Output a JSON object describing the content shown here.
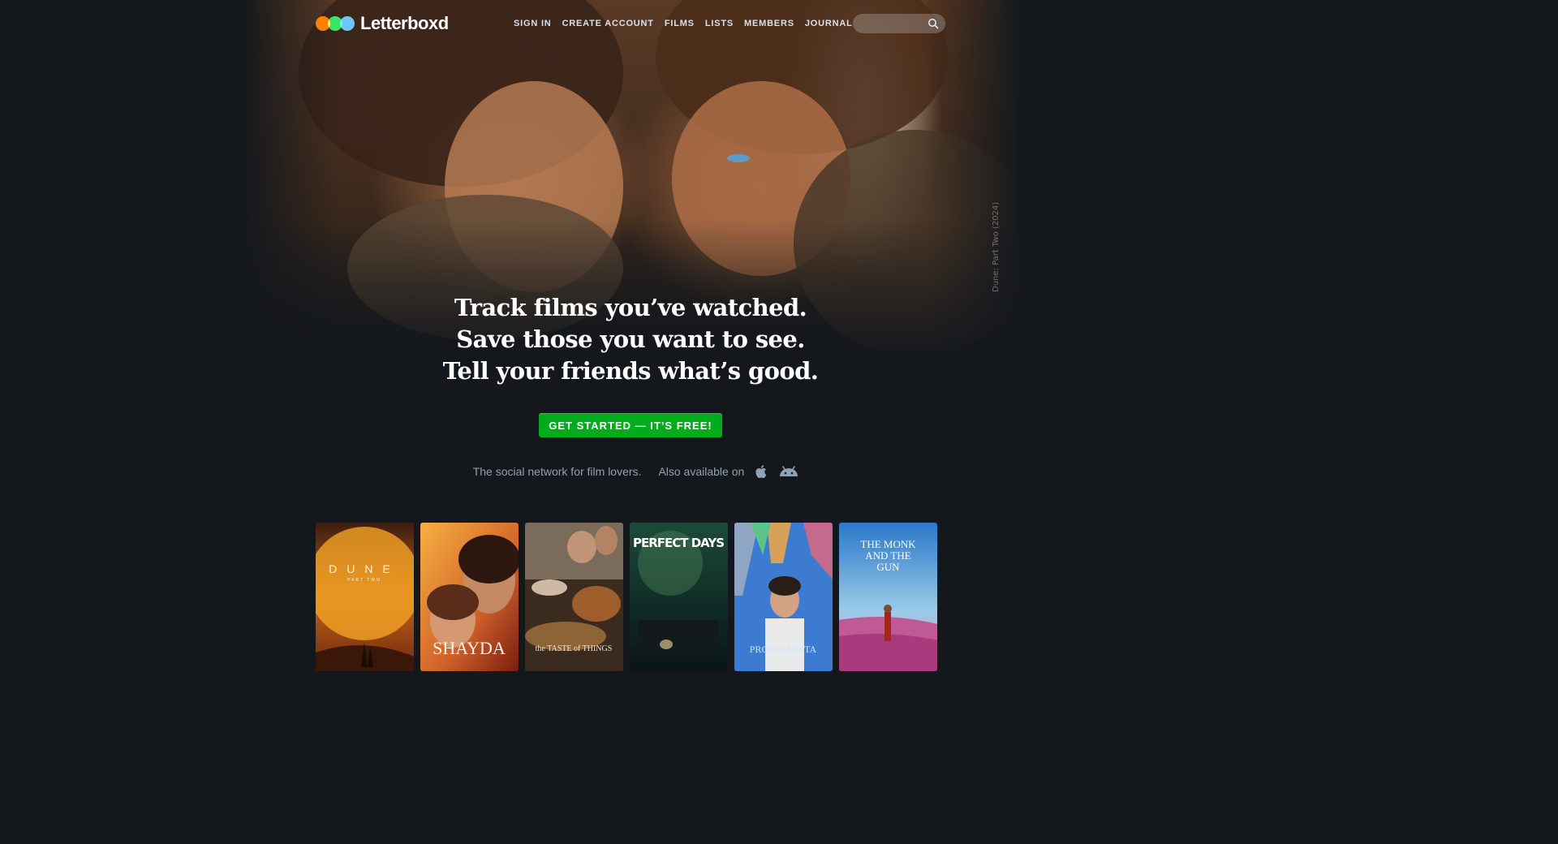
{
  "site": {
    "name": "Letterboxd"
  },
  "nav": {
    "sign_in": "SIGN IN",
    "create_account": "CREATE ACCOUNT",
    "films": "FILMS",
    "lists": "LISTS",
    "members": "MEMBERS",
    "journal": "JOURNAL"
  },
  "search": {
    "placeholder": ""
  },
  "hero": {
    "caption": "Dune: Part Two (2024)"
  },
  "tagline": {
    "line1": "Track films you’ve watched.",
    "line2": "Save those you want to see.",
    "line3": "Tell your friends what’s good."
  },
  "cta": {
    "label": "GET STARTED — IT’S FREE!"
  },
  "social": {
    "text": "The social network for film lovers.",
    "available": "Also available on",
    "apps": [
      "apple-icon",
      "android-icon"
    ]
  },
  "brand_colors": {
    "orange": "#ff8000",
    "green": "#00e054",
    "blue": "#40bcf4",
    "cta": "#00ac1c",
    "background": "#14181c"
  },
  "posters": [
    {
      "title": "DUNE",
      "subtitle": "PART TWO"
    },
    {
      "title": "SHAYDA"
    },
    {
      "title": "the TASTE of THINGS"
    },
    {
      "title": "PERFECT DAYS"
    },
    {
      "title": "PROBLEMISTA"
    },
    {
      "title": "THE MONK AND THE GUN"
    }
  ]
}
